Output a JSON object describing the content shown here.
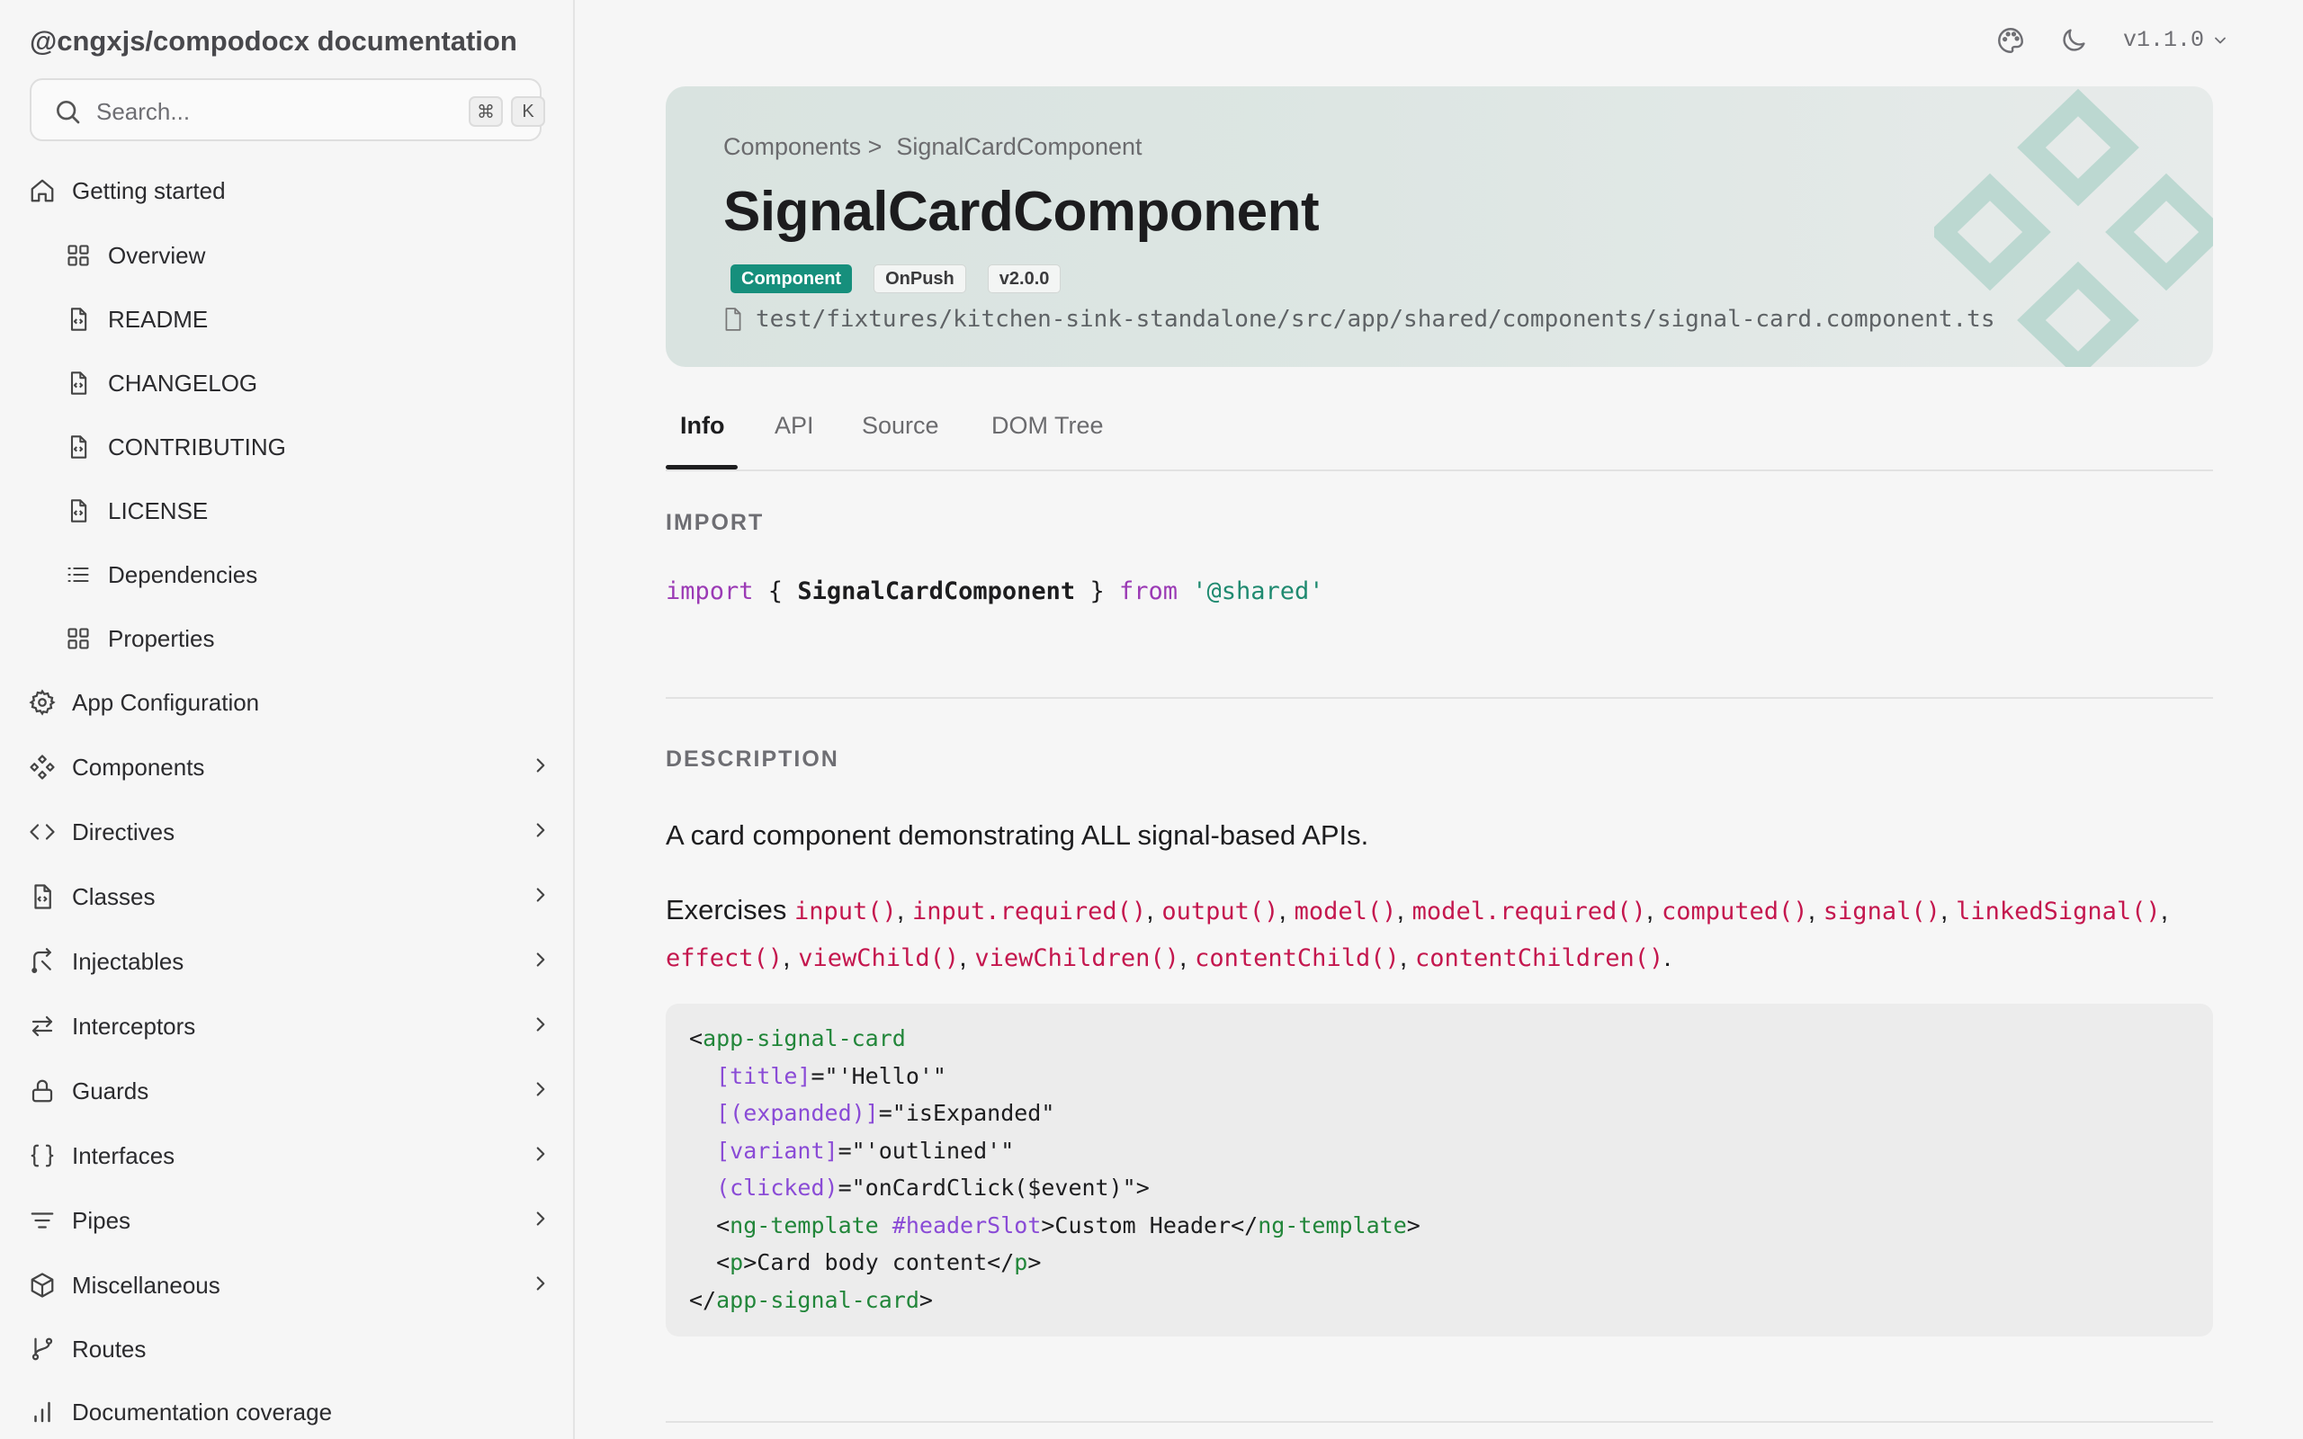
{
  "site": {
    "title": "@cngxjs/compodocx documentation"
  },
  "search": {
    "placeholder": "Search...",
    "kbd_mod": "⌘",
    "kbd_key": "K"
  },
  "sidebar": {
    "items": [
      {
        "label": "Getting started",
        "icon": "home-icon"
      },
      {
        "label": "Overview",
        "icon": "grid-icon"
      },
      {
        "label": "README",
        "icon": "file-code-icon"
      },
      {
        "label": "CHANGELOG",
        "icon": "file-code-icon"
      },
      {
        "label": "CONTRIBUTING",
        "icon": "file-code-icon"
      },
      {
        "label": "LICENSE",
        "icon": "file-code-icon"
      },
      {
        "label": "Dependencies",
        "icon": "list-icon"
      },
      {
        "label": "Properties",
        "icon": "grid-icon"
      },
      {
        "label": "App Configuration",
        "icon": "gear-icon"
      },
      {
        "label": "Components",
        "icon": "components-icon"
      },
      {
        "label": "Directives",
        "icon": "code-brackets-icon"
      },
      {
        "label": "Classes",
        "icon": "file-code-icon"
      },
      {
        "label": "Injectables",
        "icon": "injectable-icon"
      },
      {
        "label": "Interceptors",
        "icon": "arrows-swap-icon"
      },
      {
        "label": "Guards",
        "icon": "lock-icon"
      },
      {
        "label": "Interfaces",
        "icon": "braces-icon"
      },
      {
        "label": "Pipes",
        "icon": "filter-icon"
      },
      {
        "label": "Miscellaneous",
        "icon": "box-icon"
      },
      {
        "label": "Routes",
        "icon": "git-branch-icon"
      },
      {
        "label": "Documentation coverage",
        "icon": "bar-chart-icon"
      }
    ]
  },
  "topbar": {
    "version": "v1.1.0"
  },
  "header": {
    "breadcrumb_parent": "Components >",
    "breadcrumb_current": "SignalCardComponent",
    "title": "SignalCardComponent",
    "badges": [
      "Component",
      "OnPush",
      "v2.0.0"
    ],
    "file_path": "test/fixtures/kitchen-sink-standalone/src/app/shared/components/signal-card.component.ts"
  },
  "tabs": [
    "Info",
    "API",
    "Source",
    "DOM Tree"
  ],
  "import": {
    "label": "IMPORT",
    "kw_import": "import",
    "open": " { ",
    "name": "SignalCardComponent",
    "close": " } ",
    "kw_from": "from",
    "module": "'@shared'"
  },
  "description": {
    "label": "DESCRIPTION",
    "summary": "A card component demonstrating ALL signal-based APIs.",
    "exercises_prefix": "Exercises",
    "apis": [
      "input()",
      "input.required()",
      "output()",
      "model()",
      "model.required()",
      "computed()",
      "signal()",
      "linkedSignal()",
      "effect()",
      "viewChild()",
      "viewChildren()",
      "contentChild()",
      "contentChildren()"
    ],
    "code_lines": [
      "<app-signal-card",
      "  [title]=\"'Hello'\"",
      "  [(expanded)]=\"isExpanded\"",
      "  [variant]=\"'outlined'\"",
      "  (clicked)=\"onCardClick($event)\">",
      "  <ng-template #headerSlot>Custom Header</ng-template>",
      "  <p>Card body content</p>",
      "</app-signal-card>"
    ]
  },
  "colors": {
    "accent": "#168f7c",
    "code_tag": "#22863a",
    "code_attr": "#8a4bd6",
    "inline_code": "#c4174e"
  }
}
